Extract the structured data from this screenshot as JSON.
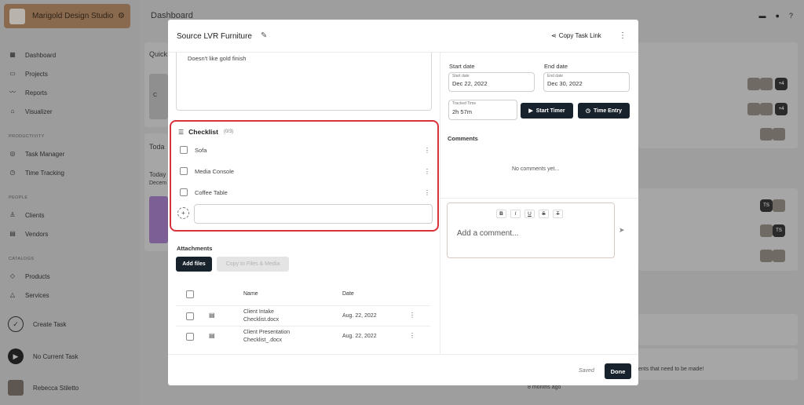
{
  "app": {
    "studio_name": "Marigold Design Studio",
    "page_title": "Dashboard",
    "nav": {
      "dashboard": "Dashboard",
      "projects": "Projects",
      "reports": "Reports",
      "visualizer": "Visualizer",
      "productivity_header": "PRODUCTIVITY",
      "task_manager": "Task Manager",
      "time_tracking": "Time Tracking",
      "people_header": "PEOPLE",
      "clients": "Clients",
      "vendors": "Vendors",
      "catalogs_header": "CATALOGS",
      "products": "Products",
      "services": "Services",
      "create_task": "Create Task",
      "no_current_task": "No Current Task",
      "user_name": "Rebecca Stiletto"
    },
    "background": {
      "quick_title": "Quick",
      "today_title": "Toda",
      "today_sub": "Today",
      "december": "Decem",
      "folder_text": "C",
      "plus4": "+4",
      "ts": "TS",
      "changes_text": "ents that need to be made!",
      "ago_text": "8 months ago"
    }
  },
  "modal": {
    "title": "Source LVR Furniture",
    "copy_link": "Copy Task Link",
    "notes_text": "Doesn't like gold finish",
    "checklist": {
      "title": "Checklist",
      "count": "(0/3)",
      "items": [
        "Sofa",
        "Media Console",
        "Coffee Table"
      ],
      "new_item_value": ""
    },
    "attachments": {
      "title": "Attachments",
      "add_files": "Add files",
      "copy_to_media": "Copy to Files & Media",
      "col_name": "Name",
      "col_date": "Date",
      "rows": [
        {
          "name": "Client Intake Checklist.docx",
          "date": "Aug. 22, 2022"
        },
        {
          "name": "Client Presentation Checklist_.docx",
          "date": "Aug. 22, 2022"
        }
      ]
    },
    "dates": {
      "start_label": "Start date",
      "start_caption": "Start date",
      "start_value": "Dec 22, 2022",
      "end_label": "End date",
      "end_caption": "End date",
      "end_value": "Dec 30, 2022"
    },
    "time": {
      "tracked_caption": "Tracked Time",
      "tracked_value": "2h 57m",
      "start_timer": "Start Timer",
      "time_entry": "Time Entry"
    },
    "comments": {
      "title": "Comments",
      "empty": "No comments yet...",
      "placeholder": "Add a comment...",
      "format": [
        "B",
        "I",
        "U",
        "S",
        "T"
      ]
    },
    "footer": {
      "saved": "Saved",
      "done": "Done"
    }
  },
  "colors": {
    "accent_dark": "#17222c",
    "highlight_red": "#d8323c",
    "overlay": "#9e9e9e"
  }
}
